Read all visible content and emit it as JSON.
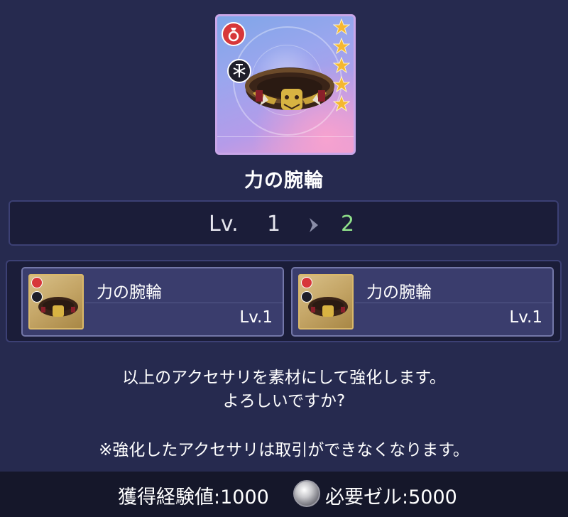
{
  "item": {
    "name": "力の腕輪",
    "rarity_stars": 5,
    "type_icon": "ring-icon",
    "element_icon": "light-element-icon"
  },
  "level": {
    "label": "Lv.",
    "from": "1",
    "to": "2"
  },
  "materials": [
    {
      "name": "力の腕輪",
      "level": "Lv.1",
      "element_icon": "jupiter-element-icon"
    },
    {
      "name": "力の腕輪",
      "level": "Lv.1",
      "element_icon": "light-element-icon"
    }
  ],
  "message": {
    "line1": "以上のアクセサリを素材にして強化します。",
    "line2": "よろしいですか?",
    "note": "※強化したアクセサリは取引ができなくなります。"
  },
  "footer": {
    "exp_text": "獲得経験値:1000",
    "cost_text": "必要ゼル:5000",
    "currency_icon": "zel-coin-icon"
  },
  "colors": {
    "background": "#262a4f",
    "panel": "#1b1d39",
    "next_level": "#8fe08a",
    "star": "#f5b731"
  }
}
